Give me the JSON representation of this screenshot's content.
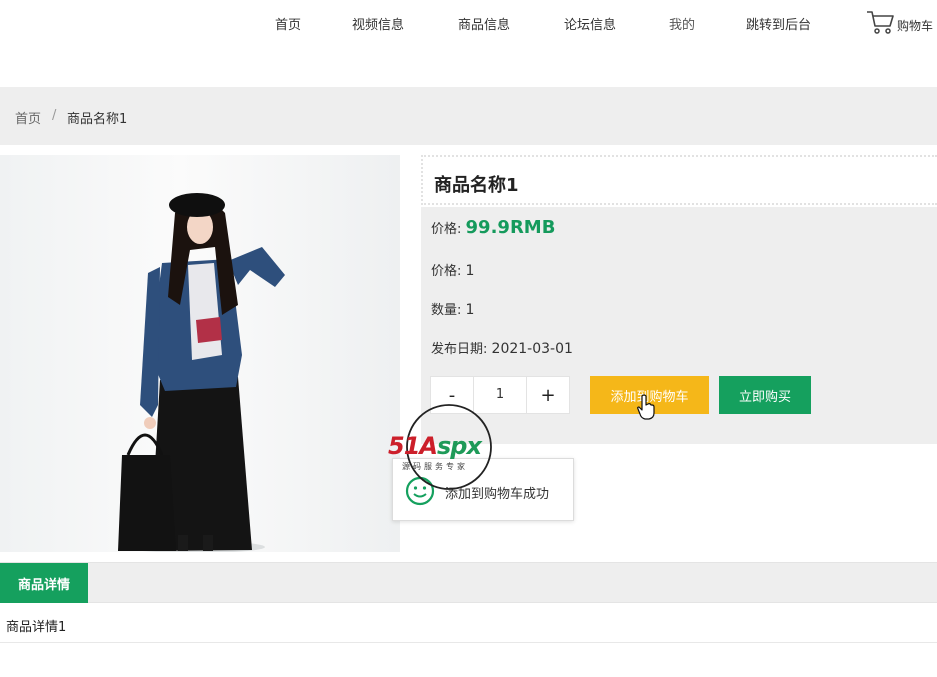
{
  "nav": {
    "items": [
      "首页",
      "视频信息",
      "商品信息",
      "论坛信息",
      "我的",
      "跳转到后台"
    ],
    "cart_label": "购物车"
  },
  "breadcrumb": {
    "home": "首页",
    "separator": "/",
    "current": "商品名称1"
  },
  "product": {
    "title": "商品名称1",
    "price_label": "价格:",
    "price_value": "99.9RMB",
    "price2_label": "价格:",
    "price2_value": "1",
    "quantity_label": "数量:",
    "quantity_value": "1",
    "date_label": "发布日期:",
    "date_value": "2021-03-01"
  },
  "stepper": {
    "minus": "-",
    "value": "1",
    "plus": "+"
  },
  "actions": {
    "add_to_cart": "添加到购物车",
    "buy_now": "立即购买"
  },
  "toast": {
    "message": "添加到购物车成功"
  },
  "watermark": {
    "brand_red": "51A",
    "brand_green": "spx",
    "subtitle": "源码服务专家"
  },
  "tabs": {
    "active_label": "商品详情",
    "content": "商品详情1"
  },
  "colors": {
    "accent_green": "#15a05e",
    "price_green": "#159a5c",
    "cart_orange": "#f5b719",
    "panel_gray": "#eeeeee"
  }
}
